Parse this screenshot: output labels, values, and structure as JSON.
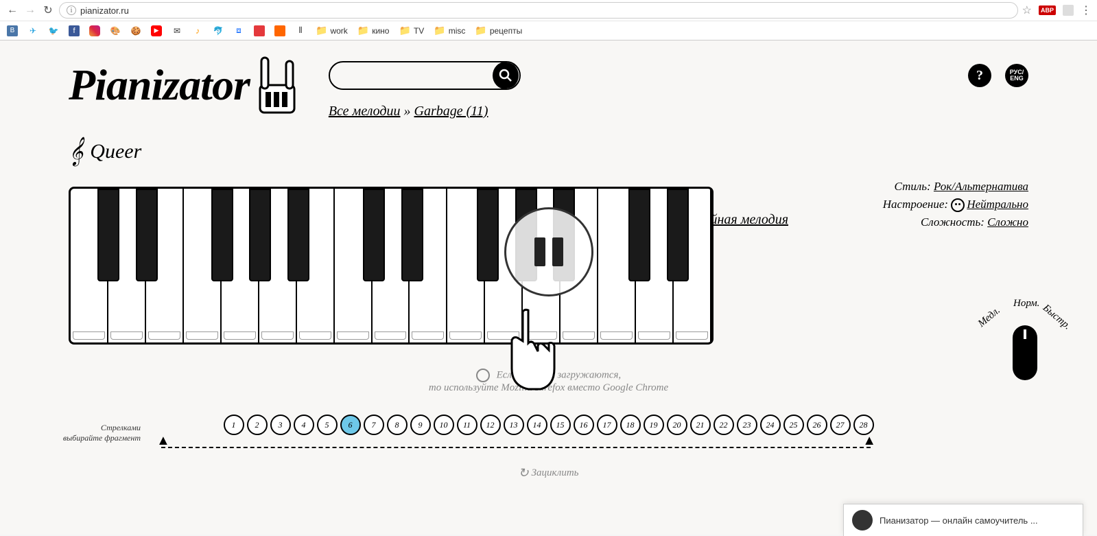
{
  "browser": {
    "url": "pianizator.ru",
    "bookmarks": [
      {
        "label": "work"
      },
      {
        "label": "кино"
      },
      {
        "label": "TV"
      },
      {
        "label": "misc"
      },
      {
        "label": "рецепты"
      }
    ]
  },
  "logo": "Pianizator",
  "lang_btn": "РУС/\nENG",
  "breadcrumb": {
    "all": "Все мелодии",
    "sep": "»",
    "artist": "Garbage (11)"
  },
  "meta": {
    "style_label": "Стиль:",
    "style_value": "Рок/Альтернатива",
    "mood_label": "Настроение:",
    "mood_value": "Нейтрально",
    "diff_label": "Сложность:",
    "diff_value": "Сложно"
  },
  "song_title": "Queer",
  "random": "Случайная мелодия",
  "tempo": {
    "slow": "Медл.",
    "norm": "Норм.",
    "fast": "Быстр."
  },
  "ff_hint": {
    "line1": "Если звуки не загружаются,",
    "line2": "то используйте Mozilla Firefox вместо Google Chrome"
  },
  "fragments": {
    "hint": "Стрелками\nвыбирайте фрагмент",
    "count": 28,
    "active": 6
  },
  "loop": "Зациклить",
  "float_widget": "Пианизатор — онлайн самоучитель ...",
  "black_key_positions": [
    0,
    1,
    3,
    4,
    5,
    7,
    8,
    10,
    11,
    12,
    14,
    15
  ],
  "white_key_count": 17
}
